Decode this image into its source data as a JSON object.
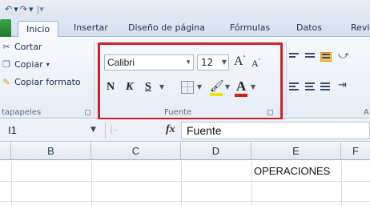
{
  "quick_access": {
    "undo": "↶",
    "undo_dd": "▾",
    "redo": "↷",
    "redo_dd": "▾",
    "customize": "|▾"
  },
  "tabs": [
    {
      "label": "Inicio",
      "active": true
    },
    {
      "label": "Insertar",
      "active": false
    },
    {
      "label": "Diseño de página",
      "active": false
    },
    {
      "label": "Fórmulas",
      "active": false
    },
    {
      "label": "Datos",
      "active": false
    },
    {
      "label": "Revi",
      "active": false
    }
  ],
  "clipboard": {
    "cut_label": "Cortar",
    "copy_label": "Copiar",
    "copy_dd": "▾",
    "format_painter_label": "Copiar formato",
    "group_label": "tapapeles"
  },
  "font_group": {
    "font_name": "Calibri",
    "font_size": "12",
    "grow_label": "A",
    "shrink_label": "A",
    "bold": "N",
    "italic": "K",
    "underline": "S",
    "color_a": "A",
    "group_label": "Fuente",
    "fill_color": "#f3e300",
    "font_color": "#d41f1f"
  },
  "alignment_group": {
    "partial_label": "A"
  },
  "formula_bar": {
    "name_box": "I1",
    "fx": "fx",
    "ghost": "(­­–",
    "content": "Fuente"
  },
  "columns": [
    "B",
    "C",
    "D",
    "E",
    "F"
  ],
  "cells": {
    "E1": "OPERACIONES"
  },
  "highlight_color": "#d21f2b"
}
